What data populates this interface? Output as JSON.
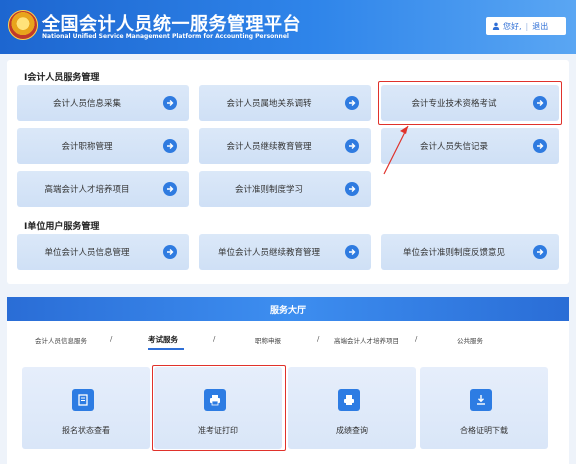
{
  "header": {
    "title_cn": "全国会计人员统一服务管理平台",
    "title_en": "National Unified Service Management Platform for Accounting Personnel",
    "greeting": "您好,",
    "logout": "退出"
  },
  "accountant_section": {
    "title": "I会计人员服务管理",
    "tiles": [
      {
        "label": "会计人员信息采集"
      },
      {
        "label": "会计人员属地关系调转"
      },
      {
        "label": "会计专业技术资格考试"
      },
      {
        "label": "会计职称管理"
      },
      {
        "label": "会计人员继续教育管理"
      },
      {
        "label": "会计人员失信记录"
      },
      {
        "label": "高端会计人才培养项目"
      },
      {
        "label": "会计准则制度学习"
      }
    ]
  },
  "unit_section": {
    "title": "I单位用户服务管理",
    "tiles": [
      {
        "label": "单位会计人员信息管理"
      },
      {
        "label": "单位会计人员继续教育管理"
      },
      {
        "label": "单位会计准则制度反馈意见"
      }
    ]
  },
  "hall": {
    "title": "服务大厅",
    "tabs": [
      {
        "label": "会计人员信息服务"
      },
      {
        "label": "考试服务"
      },
      {
        "label": "职称申报"
      },
      {
        "label": "高端会计人才培养项目"
      },
      {
        "label": "公共服务"
      }
    ],
    "separator": "/",
    "cards": [
      {
        "label": "报名状态查看",
        "icon": "report-icon"
      },
      {
        "label": "准考证打印",
        "icon": "printer-icon"
      },
      {
        "label": "成绩查询",
        "icon": "printer-doc-icon"
      },
      {
        "label": "合格证明下载",
        "icon": "download-icon"
      }
    ]
  },
  "colors": {
    "header_blue": "#2f85ea",
    "accent_blue": "#2f7be0",
    "highlight_red": "#e0322b"
  }
}
